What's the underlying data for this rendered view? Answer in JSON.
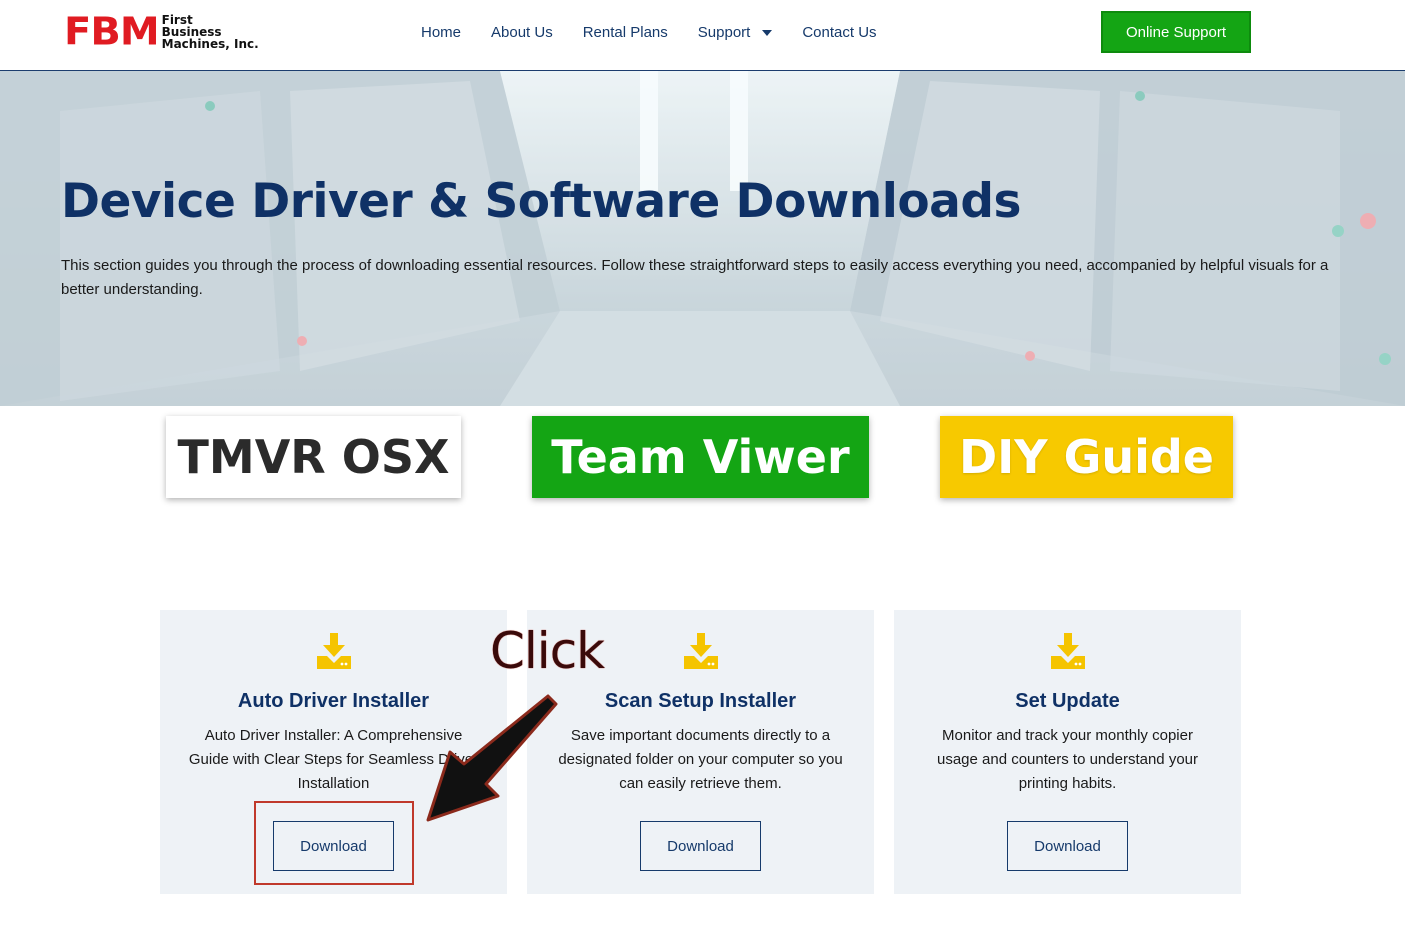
{
  "header": {
    "logo": {
      "mark": "FBM",
      "line1": "First",
      "line2": "Business",
      "line3": "Machines, Inc."
    },
    "nav": [
      {
        "label": "Home"
      },
      {
        "label": "About Us"
      },
      {
        "label": "Rental Plans"
      },
      {
        "label": "Support",
        "has_dropdown": true
      },
      {
        "label": "Contact Us"
      }
    ],
    "cta_label": "Online Support"
  },
  "hero": {
    "title": "Device Driver & Software Downloads",
    "description": "This section guides you through the process of downloading essential resources. Follow these straightforward steps to easily access everything you need, accompanied by helpful visuals for a better understanding."
  },
  "labels": [
    {
      "text": "TMVR OSX"
    },
    {
      "text": "Team Viwer"
    },
    {
      "text": "DIY Guide"
    }
  ],
  "cards": [
    {
      "title": "Auto Driver Installer",
      "description": "Auto Driver Installer: A Comprehensive Guide with Clear Steps for Seamless Driver Installation",
      "button_label": "Download"
    },
    {
      "title": "Scan Setup Installer",
      "description": "Save important documents directly to a designated folder on your computer so you can easily retrieve them.",
      "button_label": "Download"
    },
    {
      "title": "Set Update",
      "description": "Monitor and track your monthly copier usage and counters to understand your printing habits.",
      "button_label": "Download"
    }
  ],
  "annotation": {
    "text": "Click"
  },
  "colors": {
    "brand_red": "#e01b22",
    "navy": "#0f3166",
    "green": "#14a514",
    "yellow": "#f7c900",
    "icon_yellow": "#f5c400",
    "annotation_red": "#c0392b"
  }
}
